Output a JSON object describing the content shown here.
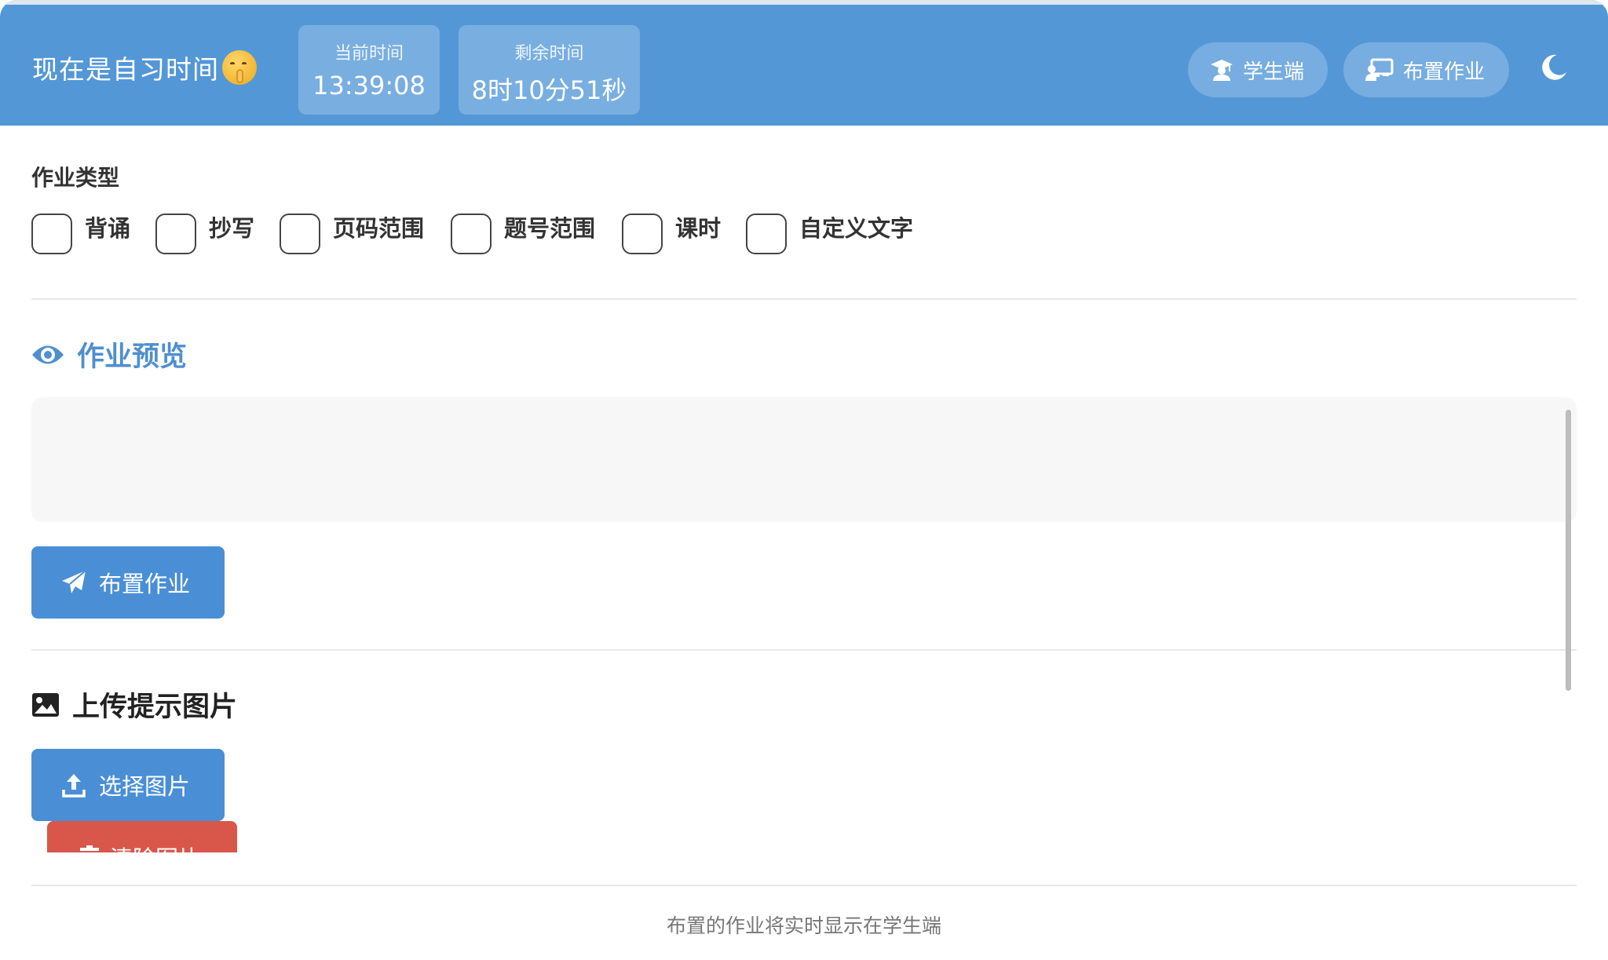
{
  "header": {
    "status_title": "现在是自习时间",
    "status_emoji": "shushing-face-icon",
    "current_time_label": "当前时间",
    "current_time_value": "13:39:08",
    "remaining_label": "剩余时间",
    "remaining_value": "8时10分51秒",
    "student_button": "学生端",
    "assign_button": "布置作业",
    "theme_toggle_icon": "moon-icon"
  },
  "homework_type": {
    "label": "作业类型",
    "options": [
      "背诵",
      "抄写",
      "页码范围",
      "题号范围",
      "课时",
      "自定义文字"
    ]
  },
  "preview": {
    "title": "作业预览",
    "content": "",
    "submit_button": "布置作业"
  },
  "upload": {
    "title": "上传提示图片",
    "choose_button": "选择图片",
    "clear_button": "清除图片"
  },
  "footer": {
    "note": "布置的作业将实时显示在学生端"
  },
  "colors": {
    "header_bg": "#5497d6",
    "accent": "#4a8fd6",
    "danger": "#d9574a",
    "preview_title": "#4f8fce"
  }
}
